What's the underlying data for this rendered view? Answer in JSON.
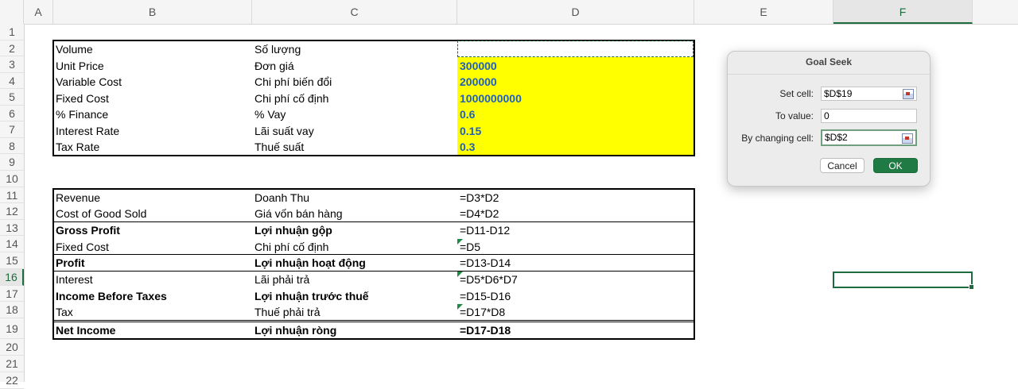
{
  "columns": [
    "A",
    "B",
    "C",
    "D",
    "E",
    "F"
  ],
  "rows": [
    "1",
    "2",
    "3",
    "4",
    "5",
    "6",
    "7",
    "8",
    "9",
    "10",
    "11",
    "12",
    "13",
    "14",
    "15",
    "16",
    "17",
    "18",
    "19",
    "20",
    "21",
    "22"
  ],
  "selected_column": "F",
  "selected_row": "16",
  "inputs": [
    {
      "en": "Volume",
      "vi": "Số lượng",
      "value": ""
    },
    {
      "en": "Unit Price",
      "vi": "Đơn giá",
      "value": "300000"
    },
    {
      "en": "Variable Cost",
      "vi": "Chi phí biến đổi",
      "value": "200000"
    },
    {
      "en": "Fixed Cost",
      "vi": "Chi phí cố định",
      "value": "1000000000"
    },
    {
      "en": "% Finance",
      "vi": "% Vay",
      "value": "0.6"
    },
    {
      "en": "Interest Rate",
      "vi": "Lãi suất vay",
      "value": "0.15"
    },
    {
      "en": "Tax Rate",
      "vi": "Thuế suất",
      "value": "0.3"
    }
  ],
  "income": [
    {
      "en": "Revenue",
      "vi": "Doanh Thu",
      "formula": "=D3*D2",
      "bold": false
    },
    {
      "en": "Cost of Good Sold",
      "vi": "Giá vốn bán hàng",
      "formula": "=D4*D2",
      "bold": false
    },
    {
      "en": "Gross Profit",
      "vi": "Lợi nhuận gộp",
      "formula": "=D11-D12",
      "bold": true
    },
    {
      "en": "Fixed Cost",
      "vi": "Chi phí cố định",
      "formula": "=D5",
      "bold": false
    },
    {
      "en": "Profit",
      "vi": "Lợi nhuận hoạt động",
      "formula": "=D13-D14",
      "bold": true
    },
    {
      "en": "Interest",
      "vi": "Lãi phải trả",
      "formula": "=D5*D6*D7",
      "bold": false
    },
    {
      "en": "Income Before Taxes",
      "vi": "Lợi nhuận trước thuế",
      "formula": "=D15-D16",
      "bold": true
    },
    {
      "en": "Tax",
      "vi": "Thuế phải trả",
      "formula": "=D17*D8",
      "bold": false
    },
    {
      "en": "Net Income",
      "vi": "Lợi nhuận ròng",
      "formula": "=D17-D18",
      "bold": true
    }
  ],
  "goal_seek": {
    "title": "Goal Seek",
    "set_cell_label": "Set cell:",
    "set_cell_value": "$D$19",
    "to_value_label": "To value:",
    "to_value_value": "0",
    "changing_label": "By changing cell:",
    "changing_value": "$D$2",
    "cancel": "Cancel",
    "ok": "OK"
  },
  "colors": {
    "accent": "#1d6b3e",
    "highlight": "#ffff00",
    "value_text": "#1f5fbf"
  }
}
